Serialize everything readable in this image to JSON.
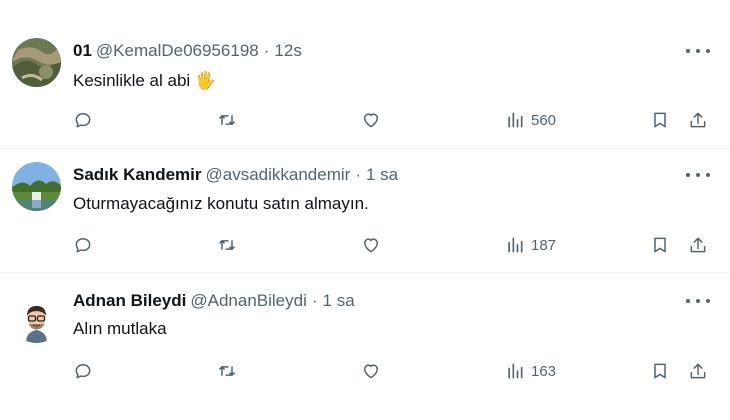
{
  "tweets": [
    {
      "name": "01",
      "handle": "@KemalDe06956198",
      "separator": "·",
      "time": "12s",
      "text": "Kesinlikle al abi 🖐",
      "views": "560",
      "avatar": "landscape photo"
    },
    {
      "name": "Sadık Kandemir",
      "handle": "@avsadikkandemir",
      "separator": "·",
      "time": "1 sa",
      "text": "Oturmayacağınız konutu satın almayın.",
      "views": "187",
      "avatar": "park photo"
    },
    {
      "name": "Adnan Bileydi",
      "handle": "@AdnanBileydi",
      "separator": "·",
      "time": "1 sa",
      "text": "Alın mutlaka",
      "views": "163",
      "avatar": "cartoon portrait"
    }
  ],
  "icons": {
    "reply": "reply-icon",
    "retweet": "retweet-icon",
    "like": "heart-icon",
    "views": "views-icon",
    "bookmark": "bookmark-icon",
    "share": "share-icon",
    "more": "more-icon"
  },
  "colors": {
    "text": "#0f1419",
    "secondary": "#536471",
    "divider": "#eff3f4"
  }
}
